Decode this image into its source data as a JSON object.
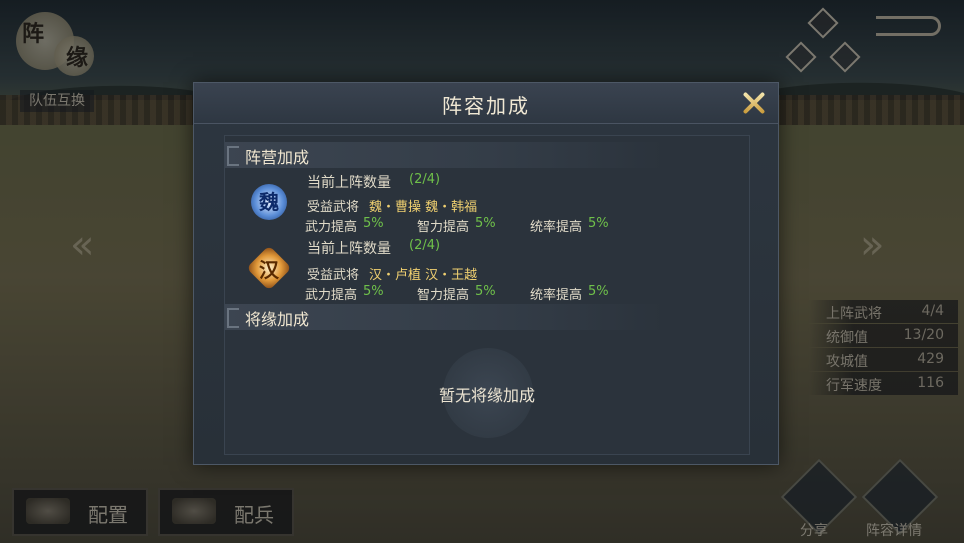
{
  "top_left": {
    "emblem_char_1": "阵",
    "emblem_char_2": "缘",
    "swap_label": "队伍互换"
  },
  "stats": [
    {
      "label": "上阵武将",
      "value": "4/4"
    },
    {
      "label": "统御值",
      "value": "13/20"
    },
    {
      "label": "攻城值",
      "value": "429"
    },
    {
      "label": "行军速度",
      "value": "116"
    }
  ],
  "bottom": {
    "config_label": "配置",
    "troops_label": "配兵",
    "share_label": "分享",
    "detail_label": "阵容详情"
  },
  "modal": {
    "title": "阵容加成",
    "camp_section": "阵营加成",
    "factions": [
      {
        "badge_char": "魏",
        "count_label": "当前上阵数量",
        "count_value": "(2/4)",
        "benefit_label": "受益武将",
        "generals": "魏・曹操 魏・韩福",
        "bonuses": [
          {
            "label": "武力提高",
            "value": "5%"
          },
          {
            "label": "智力提高",
            "value": "5%"
          },
          {
            "label": "统率提高",
            "value": "5%"
          }
        ]
      },
      {
        "badge_char": "汉",
        "count_label": "当前上阵数量",
        "count_value": "(2/4)",
        "benefit_label": "受益武将",
        "generals": "汉・卢植 汉・王越",
        "bonuses": [
          {
            "label": "武力提高",
            "value": "5%"
          },
          {
            "label": "智力提高",
            "value": "5%"
          },
          {
            "label": "统率提高",
            "value": "5%"
          }
        ]
      }
    ],
    "fate_section": "将缘加成",
    "empty_text": "暂无将缘加成"
  },
  "colors": {
    "green_value": "#6fc04a",
    "yellow_name": "#f0d070",
    "modal_bg": "#2b333c"
  },
  "icons": [
    "close-icon",
    "back-icon",
    "share-icon",
    "formation-detail-icon",
    "wei-faction-icon",
    "han-faction-icon"
  ]
}
